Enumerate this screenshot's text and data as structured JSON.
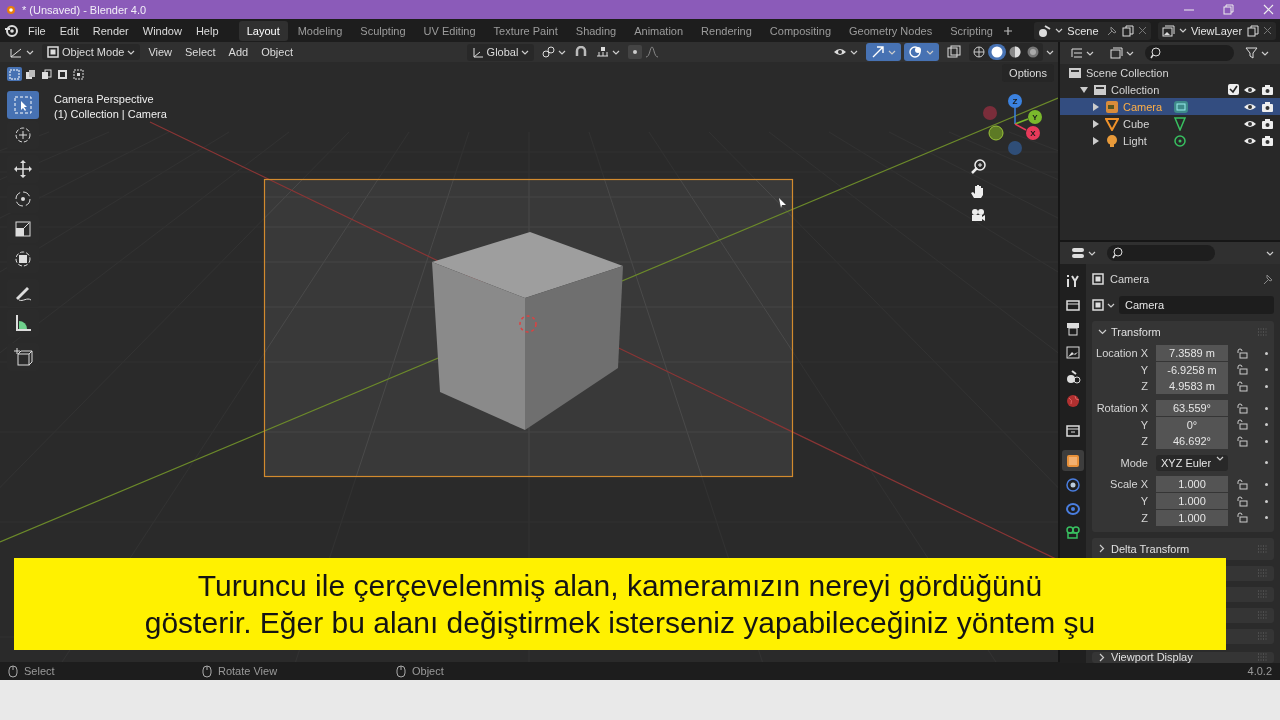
{
  "window": {
    "title": "* (Unsaved) - Blender 4.0"
  },
  "menu": [
    "File",
    "Edit",
    "Render",
    "Window",
    "Help"
  ],
  "workspaces": [
    {
      "label": "Layout",
      "selected": true
    },
    {
      "label": "Modeling",
      "selected": false
    },
    {
      "label": "Sculpting",
      "selected": false
    },
    {
      "label": "UV Editing",
      "selected": false
    },
    {
      "label": "Texture Paint",
      "selected": false
    },
    {
      "label": "Shading",
      "selected": false
    },
    {
      "label": "Animation",
      "selected": false
    },
    {
      "label": "Rendering",
      "selected": false
    },
    {
      "label": "Compositing",
      "selected": false
    },
    {
      "label": "Geometry Nodes",
      "selected": false
    },
    {
      "label": "Scripting",
      "selected": false
    }
  ],
  "scene": {
    "value": "Scene"
  },
  "view_layer": {
    "value": "ViewLayer"
  },
  "viewport": {
    "mode": "Object Mode",
    "menus": [
      "View",
      "Select",
      "Add",
      "Object"
    ],
    "orientation": "Global",
    "options": "Options",
    "toggles": [
      {
        "kind": "gizmo",
        "on": true
      },
      {
        "kind": "overlay",
        "on": true
      },
      {
        "kind": "xray",
        "on": false
      }
    ],
    "shading": [
      {
        "kind": "wireframe",
        "selected": false
      },
      {
        "kind": "solid",
        "selected": true
      },
      {
        "kind": "material",
        "selected": false
      },
      {
        "kind": "rendered",
        "selected": false
      }
    ],
    "select_modes": [
      {
        "kind": "set",
        "selected": true
      },
      {
        "kind": "extend",
        "selected": false
      },
      {
        "kind": "subtract",
        "selected": false
      },
      {
        "kind": "invert",
        "selected": false
      },
      {
        "kind": "intersect",
        "selected": false
      }
    ],
    "info": [
      "Camera Perspective",
      "(1) Collection | Camera"
    ],
    "tools": [
      {
        "kind": "select",
        "selected": true
      },
      {
        "kind": "cursor",
        "selected": false
      },
      {
        "kind": "move",
        "selected": false
      },
      {
        "kind": "rotate",
        "selected": false
      },
      {
        "kind": "scale",
        "selected": false
      },
      {
        "kind": "transform",
        "selected": false
      },
      {
        "kind": "annotate",
        "selected": false
      },
      {
        "kind": "measure",
        "selected": false
      },
      {
        "kind": "add",
        "selected": false
      }
    ],
    "gizmo": [
      {
        "label": "Z",
        "color": "#3b82e0"
      },
      {
        "label": "Y",
        "color": "#7ab82c"
      },
      {
        "label": "X",
        "color": "#e83a5a"
      }
    ]
  },
  "outliner": {
    "items": [
      {
        "label": "Scene Collection",
        "selected": false,
        "children": [
          {
            "label": "Collection",
            "selected": false,
            "checked": true,
            "expanded": true,
            "children": [
              {
                "label": "Camera",
                "kind": "camera",
                "selected": true,
                "expanded": false
              },
              {
                "label": "Cube",
                "kind": "mesh",
                "selected": false,
                "expanded": false
              },
              {
                "label": "Light",
                "kind": "light",
                "selected": false,
                "expanded": false
              }
            ]
          }
        ]
      }
    ]
  },
  "properties": {
    "tabs": [
      {
        "kind": "tool",
        "selected": false
      },
      {
        "kind": "render",
        "selected": false
      },
      {
        "kind": "output",
        "selected": false
      },
      {
        "kind": "view_layer",
        "selected": false
      },
      {
        "kind": "scene",
        "selected": false
      },
      {
        "kind": "world",
        "selected": false
      },
      {
        "kind": "collection",
        "selected": false
      },
      {
        "kind": "object",
        "selected": true
      },
      {
        "kind": "physics",
        "selected": false
      },
      {
        "kind": "constraints",
        "selected": false
      },
      {
        "kind": "data",
        "selected": false
      }
    ],
    "title": "Camera",
    "object_name": "Camera",
    "transform": {
      "label": "Transform",
      "expanded": true,
      "rows": [
        {
          "kind": "number",
          "label": "Location X",
          "value": "7.3589 m"
        },
        {
          "kind": "number",
          "label": "Y",
          "value": "-6.9258 m"
        },
        {
          "kind": "number",
          "label": "Z",
          "value": "4.9583 m"
        },
        {
          "kind": "number",
          "label": "Rotation X",
          "value": "63.559°"
        },
        {
          "kind": "number",
          "label": "Y",
          "value": "0°"
        },
        {
          "kind": "number",
          "label": "Z",
          "value": "46.692°"
        },
        {
          "kind": "dropdown",
          "label": "Mode",
          "value": "XYZ Euler"
        },
        {
          "kind": "number",
          "label": "Scale X",
          "value": "1.000"
        },
        {
          "kind": "number",
          "label": "Y",
          "value": "1.000"
        },
        {
          "kind": "number",
          "label": "Z",
          "value": "1.000"
        }
      ]
    },
    "panels": [
      {
        "label": "Delta Transform",
        "expanded": false
      },
      {
        "label": "Viewport Display",
        "expanded": false
      }
    ]
  },
  "subtitle": {
    "lines": [
      "Turuncu ile çerçevelenmiş alan, kameramızın nereyi gördüğünü",
      "gösterir. Eğer bu alanı değiştirmek isterseniz yapabileceğiniz yöntem şu"
    ]
  },
  "status_bar": {
    "items": [
      {
        "label": "Select"
      },
      {
        "label": "Rotate View"
      },
      {
        "label": "Object"
      }
    ],
    "version": "4.0.2"
  }
}
